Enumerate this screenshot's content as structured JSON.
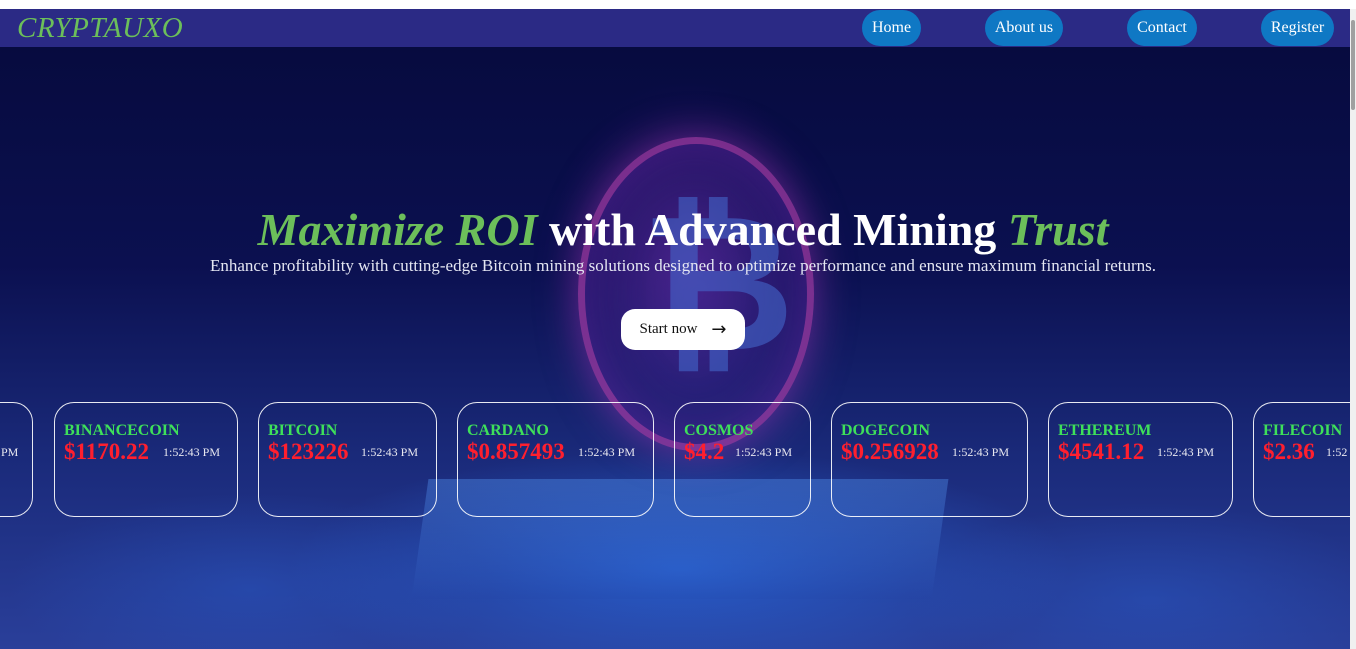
{
  "brand": "CRYPTAUXO",
  "nav": {
    "home": "Home",
    "about": "About us",
    "contact": "Contact",
    "register": "Register"
  },
  "hero": {
    "headline_part1": "Maximize ROI",
    "headline_part2": " with Advanced Mining ",
    "headline_part3": "Trust",
    "subtitle": "Enhance profitability with cutting-edge Bitcoin mining solutions designed to optimize performance and ensure maximum financial returns.",
    "cta_label": "Start now",
    "cta_icon": "arrow-right-icon"
  },
  "colors": {
    "brand_green": "#6cbf5a",
    "nav_bg": "#2b2a85",
    "nav_button": "#0f78c4",
    "coin_name": "#3ee05a",
    "coin_price": "#ff1f2e"
  },
  "ticker": {
    "partial_left_time": "PM",
    "items": [
      {
        "name": "BINANCECOIN",
        "price": "$1170.22",
        "time": "1:52:43 PM"
      },
      {
        "name": "BITCOIN",
        "price": "$123226",
        "time": "1:52:43 PM"
      },
      {
        "name": "CARDANO",
        "price": "$0.857493",
        "time": "1:52:43 PM"
      },
      {
        "name": "COSMOS",
        "price": "$4.2",
        "time": "1:52:43 PM"
      },
      {
        "name": "DOGECOIN",
        "price": "$0.256928",
        "time": "1:52:43 PM"
      },
      {
        "name": "ETHEREUM",
        "price": "$4541.12",
        "time": "1:52:43 PM"
      },
      {
        "name": "FILECOIN",
        "price": "$2.36",
        "time": "1:52"
      }
    ]
  }
}
